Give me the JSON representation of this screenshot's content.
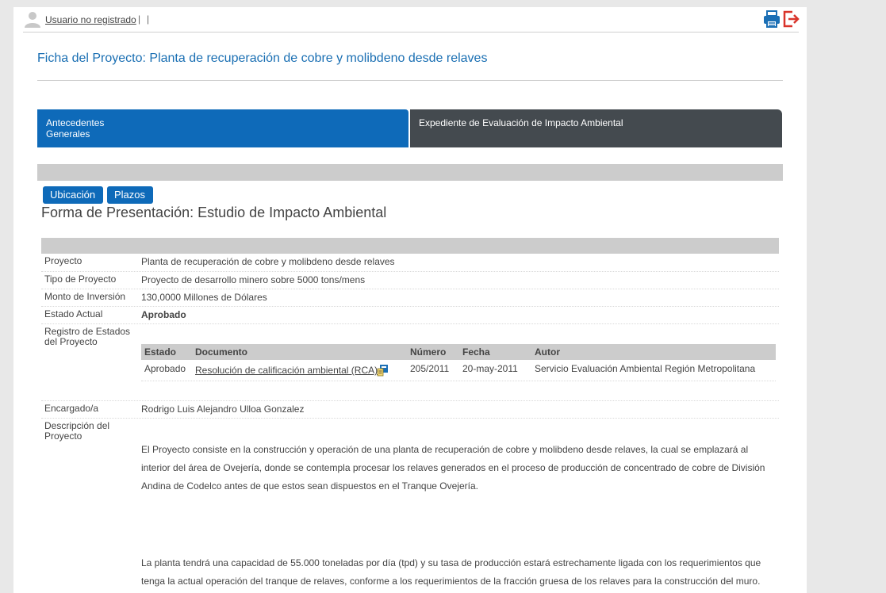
{
  "header": {
    "user_link": "Usuario no registrado",
    "separator": "|",
    "icons": [
      "user-icon",
      "print-icon",
      "exit-icon"
    ]
  },
  "title": "Ficha del Proyecto: Planta de recuperación de cobre y molibdeno desde relaves",
  "tabs": [
    {
      "label_line1": "Antecedentes",
      "label_line2": "Generales",
      "active": true
    },
    {
      "label": "Expediente de Evaluación de Impacto Ambiental",
      "active": false
    }
  ],
  "buttons": {
    "ubicacion": "Ubicación",
    "plazos": "Plazos"
  },
  "forma_presentacion": "Forma de Presentación: Estudio de Impacto Ambiental",
  "fields": {
    "proyecto": {
      "label": "Proyecto",
      "value": "Planta de recuperación de cobre y molibdeno desde relaves"
    },
    "tipo": {
      "label": "Tipo de Proyecto",
      "value": "Proyecto de desarrollo minero sobre 5000 tons/mens"
    },
    "monto": {
      "label": "Monto de Inversión",
      "value": "130,0000 Millones de Dólares"
    },
    "estado": {
      "label": "Estado Actual",
      "value": "Aprobado"
    },
    "registro": {
      "label_line1": "Registro de Estados",
      "label_line2": "del Proyecto"
    },
    "encargado": {
      "label": "Encargado/a",
      "value": "Rodrigo Luis Alejandro Ulloa Gonzalez"
    },
    "descripcion": {
      "label_line1": "Descripción del",
      "label_line2": "Proyecto"
    }
  },
  "estados_table": {
    "headers": {
      "estado": "Estado",
      "documento": "Documento",
      "numero": "Número",
      "fecha": "Fecha",
      "autor": "Autor"
    },
    "rows": [
      {
        "estado": "Aprobado",
        "documento": "Resolución de calificación ambiental (RCA)",
        "numero": "205/2011",
        "fecha": "20-may-2011",
        "autor": "Servicio Evaluación Ambiental Región Metropolitana"
      }
    ]
  },
  "descripcion": {
    "p1": " El Proyecto consiste en la construcción y operación de una planta de recuperación de cobre y molibdeno desde relaves, la cual se emplazará al interior del área de Ovejería, donde se contempla procesar los relaves generados en el proceso de producción de concentrado de cobre de División Andina de Codelco antes de que estos sean dispuestos en el Tranque Ovejería.",
    "p2": "La planta tendrá una capacidad de 55.000 toneladas por día (tpd) y su tasa de producción estará estrechamente ligada con los requerimientos que tenga la actual operación del tranque de relaves, conforme a los requerimientos de la fracción gruesa de los relaves para la construcción del muro."
  },
  "colors": {
    "accent_blue": "#0e6ab9",
    "title_blue": "#1a6fb3",
    "tab_dark": "#444a4f",
    "exit_red": "#d9342b"
  }
}
